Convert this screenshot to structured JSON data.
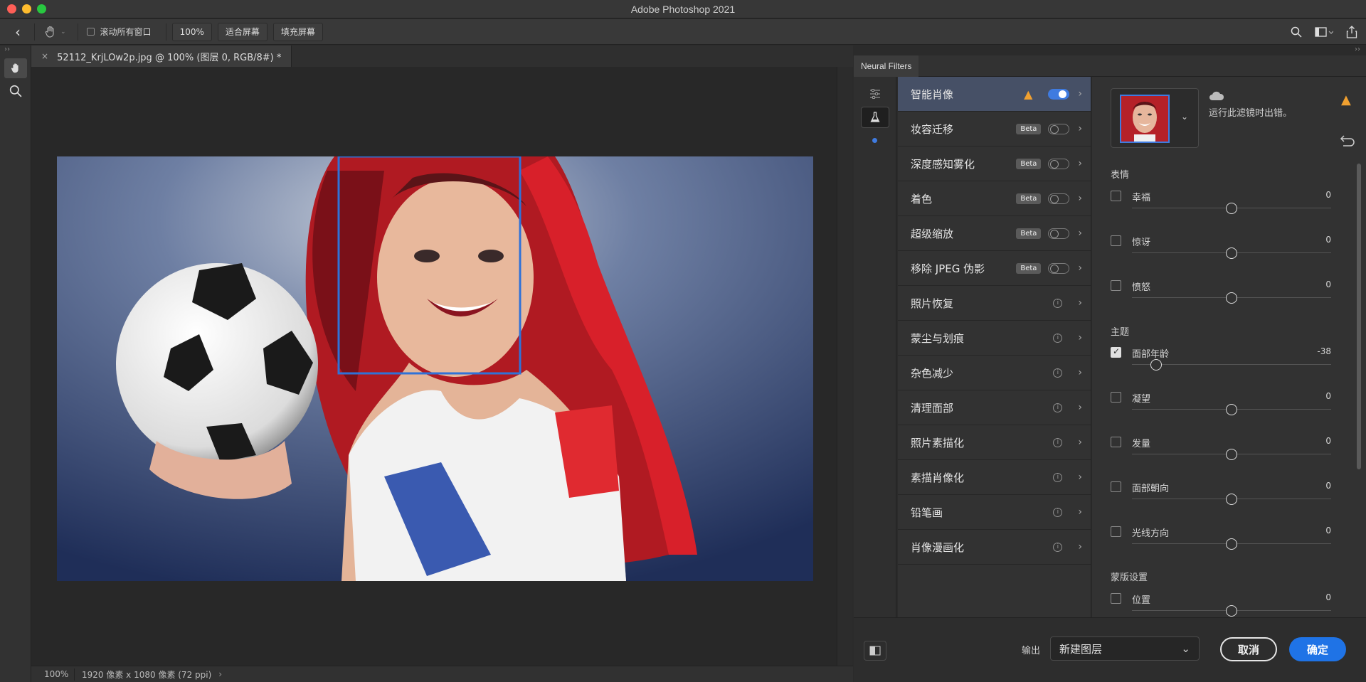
{
  "window": {
    "title": "Adobe Photoshop 2021"
  },
  "options_bar": {
    "scroll_all_label": "滚动所有窗口",
    "zoom_value": "100%",
    "fit_screen": "适合屏幕",
    "fill_screen": "填充屏幕"
  },
  "document": {
    "tab_title": "52112_KrjLOw2p.jpg @ 100% (图层 0, RGB/8#) *"
  },
  "status": {
    "zoom": "100%",
    "doc_info": "1920 像素 x 1080 像素 (72 ppi)"
  },
  "neural_filters": {
    "panel_title": "Neural Filters",
    "filters": [
      {
        "label": "智能肖像",
        "state": "on"
      },
      {
        "label": "妆容迁移",
        "badge": "Beta",
        "state": "off"
      },
      {
        "label": "深度感知雾化",
        "badge": "Beta",
        "state": "off"
      },
      {
        "label": "着色",
        "badge": "Beta",
        "state": "off"
      },
      {
        "label": "超级缩放",
        "badge": "Beta",
        "state": "off"
      },
      {
        "label": "移除 JPEG 伪影",
        "badge": "Beta",
        "state": "off"
      },
      {
        "label": "照片恢复",
        "state": "info"
      },
      {
        "label": "蒙尘与划痕",
        "state": "info"
      },
      {
        "label": "杂色减少",
        "state": "info"
      },
      {
        "label": "清理面部",
        "state": "info"
      },
      {
        "label": "照片素描化",
        "state": "info"
      },
      {
        "label": "素描肖像化",
        "state": "info"
      },
      {
        "label": "铅笔画",
        "state": "info"
      },
      {
        "label": "肖像漫画化",
        "state": "info"
      }
    ],
    "error_message": "运行此滤镜时出错。",
    "sections": {
      "expression": "表情",
      "theme": "主题",
      "mask": "蒙版设置"
    },
    "sliders": [
      {
        "label": "幸福",
        "value": "0",
        "checked": false,
        "level": 0.5
      },
      {
        "label": "惊讶",
        "value": "0",
        "checked": false,
        "level": 0.5
      },
      {
        "label": "愤怒",
        "value": "0",
        "checked": false,
        "level": 0.5
      },
      {
        "label": "面部年龄",
        "value": "-38",
        "checked": true,
        "level": 0.12
      },
      {
        "label": "凝望",
        "value": "0",
        "checked": false,
        "level": 0.5
      },
      {
        "label": "发量",
        "value": "0",
        "checked": false,
        "level": 0.5
      },
      {
        "label": "面部朝向",
        "value": "0",
        "checked": false,
        "level": 0.5
      },
      {
        "label": "光线方向",
        "value": "0",
        "checked": false,
        "level": 0.5
      },
      {
        "label": "位置",
        "value": "0",
        "checked": false,
        "level": 0.5
      }
    ],
    "output_label": "输出",
    "output_value": "新建图层",
    "cancel": "取消",
    "ok": "确定"
  },
  "colors": {
    "accent": "#3f7be0",
    "warning": "#f0a030",
    "panel": "#323232"
  }
}
